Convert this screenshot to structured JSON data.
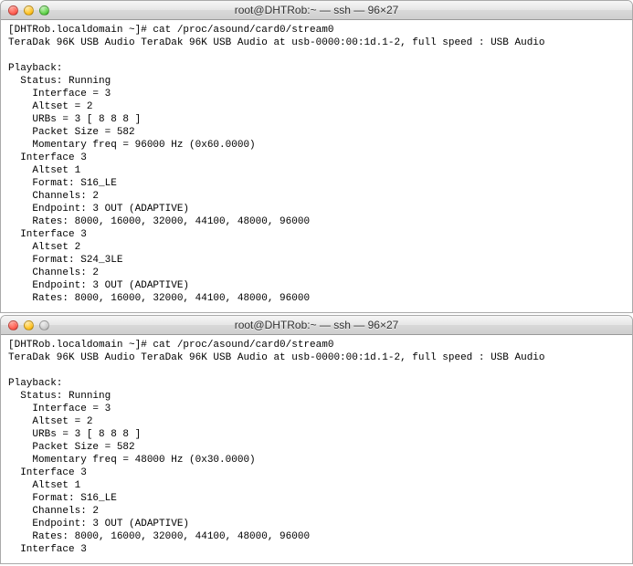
{
  "windows": [
    {
      "title": "root@DHTRob:~ — ssh — 96×27",
      "green_disabled": false,
      "prompt": "[DHTRob.localdomain ~]# cat /proc/asound/card0/stream0",
      "device_line": "TeraDak 96K USB Audio TeraDak 96K USB Audio at usb-0000:00:1d.1-2, full speed : USB Audio",
      "playback_header": "Playback:",
      "status_line": "  Status: Running",
      "fields": [
        "    Interface = 3",
        "    Altset = 2",
        "    URBs = 3 [ 8 8 8 ]",
        "    Packet Size = 582",
        "    Momentary freq = 96000 Hz (0x60.0000)"
      ],
      "interfaces": [
        {
          "header": "  Interface 3",
          "lines": [
            "    Altset 1",
            "    Format: S16_LE",
            "    Channels: 2",
            "    Endpoint: 3 OUT (ADAPTIVE)",
            "    Rates: 8000, 16000, 32000, 44100, 48000, 96000"
          ]
        },
        {
          "header": "  Interface 3",
          "lines": [
            "    Altset 2",
            "    Format: S24_3LE",
            "    Channels: 2",
            "    Endpoint: 3 OUT (ADAPTIVE)",
            "    Rates: 8000, 16000, 32000, 44100, 48000, 96000"
          ]
        }
      ]
    },
    {
      "title": "root@DHTRob:~ — ssh — 96×27",
      "green_disabled": true,
      "prompt": "[DHTRob.localdomain ~]# cat /proc/asound/card0/stream0",
      "device_line": "TeraDak 96K USB Audio TeraDak 96K USB Audio at usb-0000:00:1d.1-2, full speed : USB Audio",
      "playback_header": "Playback:",
      "status_line": "  Status: Running",
      "fields": [
        "    Interface = 3",
        "    Altset = 2",
        "    URBs = 3 [ 8 8 8 ]",
        "    Packet Size = 582",
        "    Momentary freq = 48000 Hz (0x30.0000)"
      ],
      "interfaces": [
        {
          "header": "  Interface 3",
          "lines": [
            "    Altset 1",
            "    Format: S16_LE",
            "    Channels: 2",
            "    Endpoint: 3 OUT (ADAPTIVE)",
            "    Rates: 8000, 16000, 32000, 44100, 48000, 96000"
          ]
        },
        {
          "header": "  Interface 3",
          "lines": []
        }
      ]
    }
  ]
}
